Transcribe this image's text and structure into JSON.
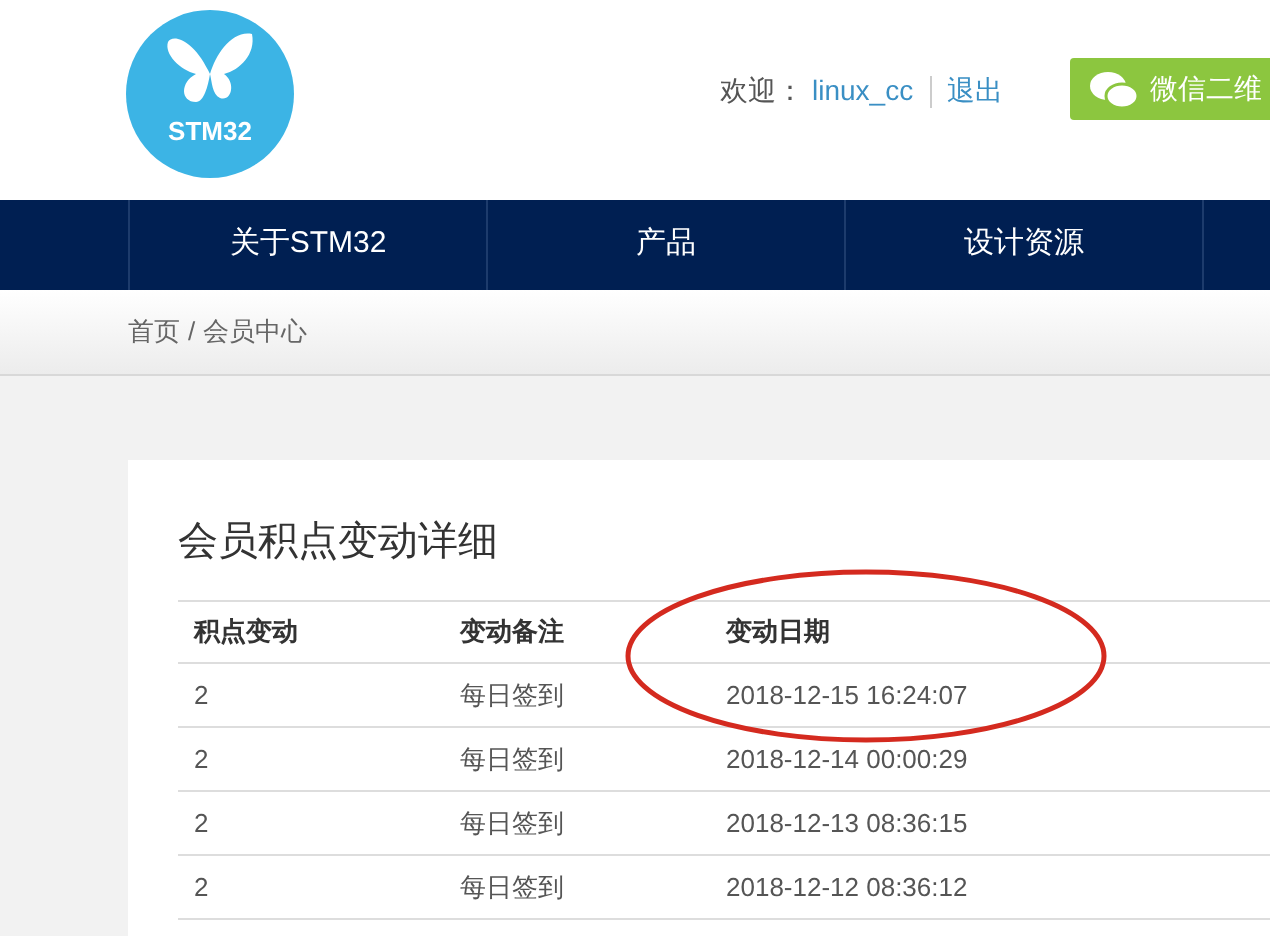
{
  "header": {
    "logo_text": "STM32",
    "welcome_label": "欢迎：",
    "username": "linux_cc",
    "logout": "退出",
    "wechat_button": "微信二维"
  },
  "nav": {
    "items": [
      {
        "label": "关于STM32"
      },
      {
        "label": "产品"
      },
      {
        "label": "设计资源"
      }
    ]
  },
  "breadcrumb": {
    "items": [
      "首页",
      "会员中心"
    ],
    "separator": "/"
  },
  "panel": {
    "title": "会员积点变动详细"
  },
  "table": {
    "columns": [
      "积点变动",
      "变动备注",
      "变动日期"
    ],
    "rows": [
      [
        "2",
        "每日签到",
        "2018-12-15 16:24:07"
      ],
      [
        "2",
        "每日签到",
        "2018-12-14 00:00:29"
      ],
      [
        "2",
        "每日签到",
        "2018-12-13 08:36:15"
      ],
      [
        "2",
        "每日签到",
        "2018-12-12 08:36:12"
      ]
    ]
  }
}
